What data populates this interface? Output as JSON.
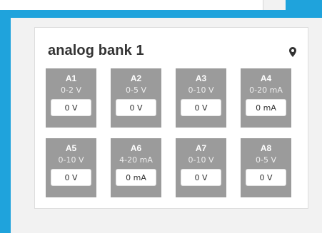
{
  "bank": {
    "title": "analog bank 1",
    "location_icon": "map-pin-icon"
  },
  "channels": [
    {
      "name": "A1",
      "range": "0-2 V",
      "value": "0 V"
    },
    {
      "name": "A2",
      "range": "0-5 V",
      "value": "0 V"
    },
    {
      "name": "A3",
      "range": "0-10 V",
      "value": "0 V"
    },
    {
      "name": "A4",
      "range": "0-20 mA",
      "value": "0 mA"
    },
    {
      "name": "A5",
      "range": "0-10 V",
      "value": "0 V"
    },
    {
      "name": "A6",
      "range": "4-20 mA",
      "value": "0 mA"
    },
    {
      "name": "A7",
      "range": "0-10 V",
      "value": "0 V"
    },
    {
      "name": "A8",
      "range": "0-5 V",
      "value": "0 V"
    }
  ],
  "colors": {
    "background_blue": "#1fa3dc",
    "panel_gray": "#f2f2f2",
    "channel_gray": "#9b9b9b",
    "title_text": "#333333"
  }
}
